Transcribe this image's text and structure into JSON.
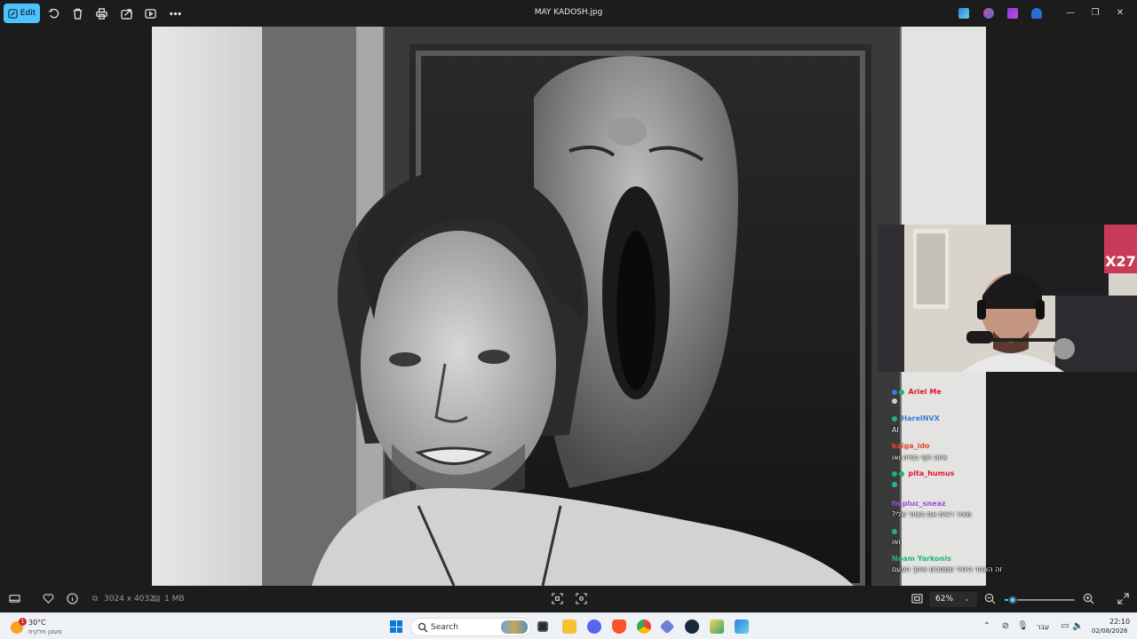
{
  "toolbar": {
    "edit_label": "Edit",
    "title": "MAY KADOSH.jpg"
  },
  "icons": {
    "rotate": "rotate-icon",
    "delete": "trash-icon",
    "print": "print-icon",
    "share": "share-icon",
    "slideshow": "slideshow-icon",
    "more": "more-icon"
  },
  "webcam": {
    "badge": "X27"
  },
  "chat": [
    {
      "name": "Ariel Me",
      "color": "#e0162b",
      "message": ""
    },
    {
      "name": "",
      "color": "",
      "message": ""
    },
    {
      "name": "HarelNVX",
      "color": "#3a7bd5",
      "message": "AI"
    },
    {
      "name": "kaiga_ido",
      "color": "#e24a2c",
      "message": "איזה זיוף כפייה ואו"
    },
    {
      "name": "pita_humus",
      "color": "#e0162b",
      "message": ""
    },
    {
      "name": "fmpluc_sneaz",
      "color": "#9b4dd8",
      "message": "?מאיר ראית את הציור שלי"
    },
    {
      "name": "",
      "color": "#4aa3e0",
      "message": "ואו"
    },
    {
      "name": "Noam Yarkonis",
      "color": "#21b573",
      "message": "זה האחד היחיד שמסכים איתך הפעם"
    }
  ],
  "infobar": {
    "dimensions": "3024 x 4032",
    "filesize": "1 MB",
    "zoom": "62%",
    "zoom_fraction": 0.12
  },
  "taskbar": {
    "weather_temp": "30°C",
    "weather_cond": "מעונן חלקית",
    "weather_badge": "1",
    "search_label": "Search",
    "language": "עבר",
    "time": "22:10",
    "date": "02/08/2026"
  }
}
